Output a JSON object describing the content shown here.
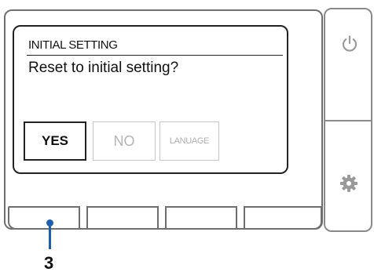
{
  "screen": {
    "title": "INITIAL SETTING",
    "message": "Reset to initial setting?"
  },
  "buttons": {
    "yes": "YES",
    "no": "NO",
    "language": "LANUAGE"
  },
  "callout": {
    "number": "3"
  },
  "icons": {
    "power": "power-icon",
    "settings": "gear-icon"
  },
  "colors": {
    "callout": "#1f5fae",
    "disabled_text": "#b5b5b5"
  }
}
